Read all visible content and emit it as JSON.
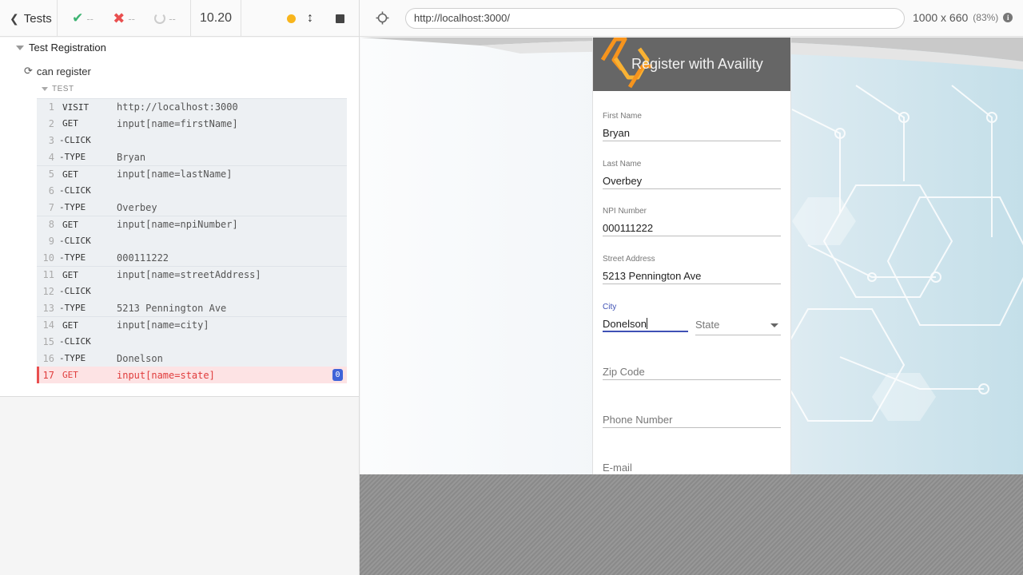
{
  "reporter": {
    "back_label": "Tests",
    "passed": "--",
    "failed": "--",
    "pending": "--",
    "duration": "10.20",
    "suite_title": "Test Registration",
    "test_title": "can register",
    "section_label": "TEST",
    "commands": [
      {
        "num": "1",
        "name": "VISIT",
        "arg": "http://localhost:3000"
      },
      {
        "num": "2",
        "name": "GET",
        "arg": "input[name=firstName]"
      },
      {
        "num": "3",
        "name": "-CLICK",
        "arg": ""
      },
      {
        "num": "4",
        "name": "-TYPE",
        "arg": "Bryan"
      },
      {
        "num": "5",
        "name": "GET",
        "arg": "input[name=lastName]"
      },
      {
        "num": "6",
        "name": "-CLICK",
        "arg": ""
      },
      {
        "num": "7",
        "name": "-TYPE",
        "arg": "Overbey"
      },
      {
        "num": "8",
        "name": "GET",
        "arg": "input[name=npiNumber]"
      },
      {
        "num": "9",
        "name": "-CLICK",
        "arg": ""
      },
      {
        "num": "10",
        "name": "-TYPE",
        "arg": "000111222"
      },
      {
        "num": "11",
        "name": "GET",
        "arg": "input[name=streetAddress]"
      },
      {
        "num": "12",
        "name": "-CLICK",
        "arg": ""
      },
      {
        "num": "13",
        "name": "-TYPE",
        "arg": "5213 Pennington Ave"
      },
      {
        "num": "14",
        "name": "GET",
        "arg": "input[name=city]"
      },
      {
        "num": "15",
        "name": "-CLICK",
        "arg": ""
      },
      {
        "num": "16",
        "name": "-TYPE",
        "arg": "Donelson"
      },
      {
        "num": "17",
        "name": "GET",
        "arg": "input[name=state]",
        "badge": "0"
      }
    ]
  },
  "preview": {
    "url": "http://localhost:3000/",
    "viewport_size": "1000 x 660",
    "scale": "(83%)"
  },
  "form": {
    "title": "Register with Availity",
    "first_name": {
      "label": "First Name",
      "value": "Bryan"
    },
    "last_name": {
      "label": "Last Name",
      "value": "Overbey"
    },
    "npi": {
      "label": "NPI Number",
      "value": "000111222"
    },
    "street": {
      "label": "Street Address",
      "value": "5213 Pennington Ave"
    },
    "city": {
      "label": "City",
      "value": "Donelson"
    },
    "state": {
      "placeholder": "State"
    },
    "zip": {
      "placeholder": "Zip Code"
    },
    "phone": {
      "placeholder": "Phone Number"
    },
    "email": {
      "placeholder": "E-mail"
    }
  },
  "colors": {
    "pass": "#3cb371",
    "fail": "#e94f4f",
    "focus": "#3f51b5",
    "header_gray": "#666666",
    "logo_orange": "#f7941d"
  }
}
